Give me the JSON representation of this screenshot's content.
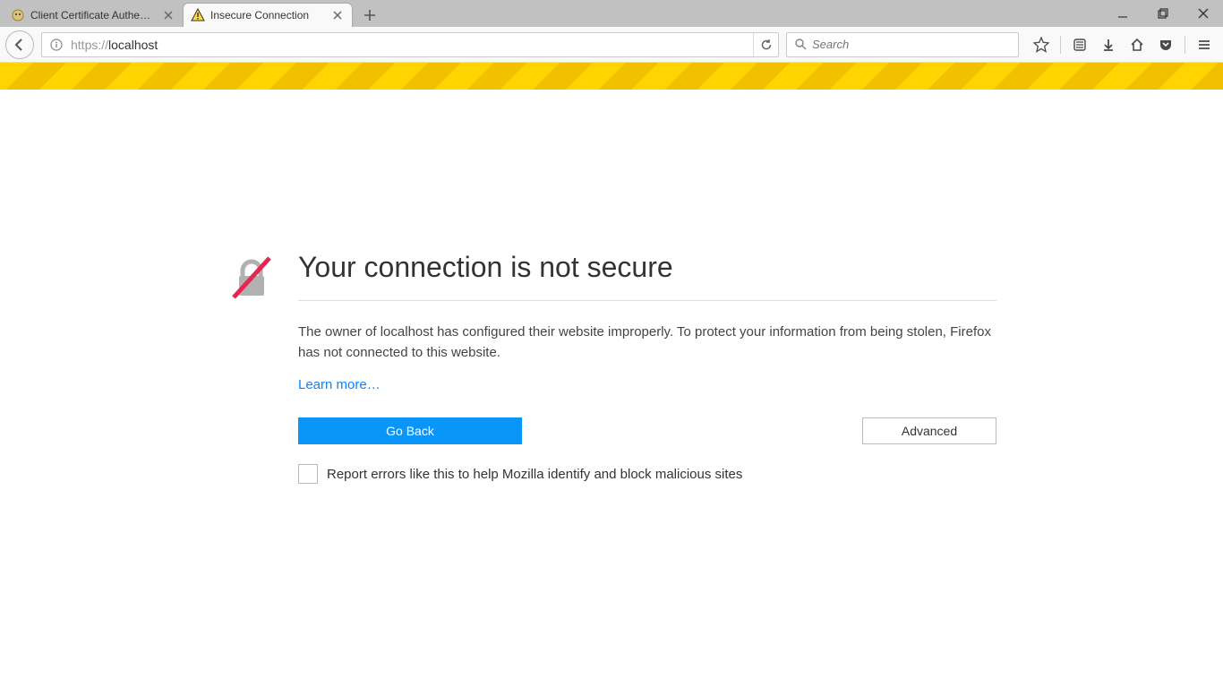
{
  "tabs": [
    {
      "title": "Client Certificate Authenti...",
      "active": false,
      "favicon": "tomcat"
    },
    {
      "title": "Insecure Connection",
      "active": true,
      "favicon": "warning"
    }
  ],
  "urlbar": {
    "protocol": "https://",
    "host": "localhost"
  },
  "searchbar": {
    "placeholder": "Search"
  },
  "error": {
    "heading": "Your connection is not secure",
    "description": "The owner of localhost has configured their website improperly. To protect your information from being stolen, Firefox has not connected to this website.",
    "learn_more": "Learn more…",
    "go_back": "Go Back",
    "advanced": "Advanced",
    "report_label": "Report errors like this to help Mozilla identify and block malicious sites"
  }
}
